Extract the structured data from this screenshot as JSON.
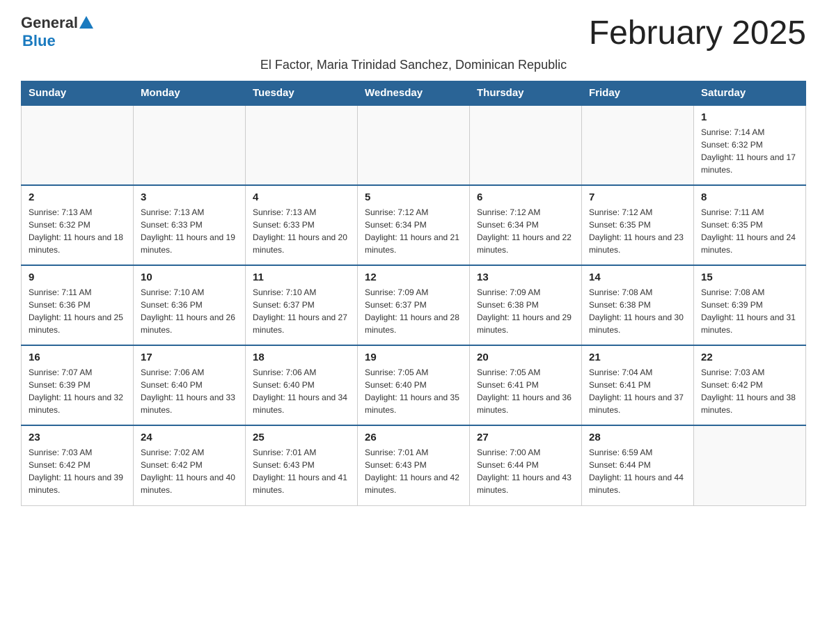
{
  "header": {
    "title": "February 2025",
    "location": "El Factor, Maria Trinidad Sanchez, Dominican Republic"
  },
  "logo": {
    "line1": "General",
    "line2": "Blue"
  },
  "weekdays": [
    "Sunday",
    "Monday",
    "Tuesday",
    "Wednesday",
    "Thursday",
    "Friday",
    "Saturday"
  ],
  "weeks": [
    {
      "days": [
        {
          "number": "",
          "info": ""
        },
        {
          "number": "",
          "info": ""
        },
        {
          "number": "",
          "info": ""
        },
        {
          "number": "",
          "info": ""
        },
        {
          "number": "",
          "info": ""
        },
        {
          "number": "",
          "info": ""
        },
        {
          "number": "1",
          "info": "Sunrise: 7:14 AM\nSunset: 6:32 PM\nDaylight: 11 hours and 17 minutes."
        }
      ]
    },
    {
      "days": [
        {
          "number": "2",
          "info": "Sunrise: 7:13 AM\nSunset: 6:32 PM\nDaylight: 11 hours and 18 minutes."
        },
        {
          "number": "3",
          "info": "Sunrise: 7:13 AM\nSunset: 6:33 PM\nDaylight: 11 hours and 19 minutes."
        },
        {
          "number": "4",
          "info": "Sunrise: 7:13 AM\nSunset: 6:33 PM\nDaylight: 11 hours and 20 minutes."
        },
        {
          "number": "5",
          "info": "Sunrise: 7:12 AM\nSunset: 6:34 PM\nDaylight: 11 hours and 21 minutes."
        },
        {
          "number": "6",
          "info": "Sunrise: 7:12 AM\nSunset: 6:34 PM\nDaylight: 11 hours and 22 minutes."
        },
        {
          "number": "7",
          "info": "Sunrise: 7:12 AM\nSunset: 6:35 PM\nDaylight: 11 hours and 23 minutes."
        },
        {
          "number": "8",
          "info": "Sunrise: 7:11 AM\nSunset: 6:35 PM\nDaylight: 11 hours and 24 minutes."
        }
      ]
    },
    {
      "days": [
        {
          "number": "9",
          "info": "Sunrise: 7:11 AM\nSunset: 6:36 PM\nDaylight: 11 hours and 25 minutes."
        },
        {
          "number": "10",
          "info": "Sunrise: 7:10 AM\nSunset: 6:36 PM\nDaylight: 11 hours and 26 minutes."
        },
        {
          "number": "11",
          "info": "Sunrise: 7:10 AM\nSunset: 6:37 PM\nDaylight: 11 hours and 27 minutes."
        },
        {
          "number": "12",
          "info": "Sunrise: 7:09 AM\nSunset: 6:37 PM\nDaylight: 11 hours and 28 minutes."
        },
        {
          "number": "13",
          "info": "Sunrise: 7:09 AM\nSunset: 6:38 PM\nDaylight: 11 hours and 29 minutes."
        },
        {
          "number": "14",
          "info": "Sunrise: 7:08 AM\nSunset: 6:38 PM\nDaylight: 11 hours and 30 minutes."
        },
        {
          "number": "15",
          "info": "Sunrise: 7:08 AM\nSunset: 6:39 PM\nDaylight: 11 hours and 31 minutes."
        }
      ]
    },
    {
      "days": [
        {
          "number": "16",
          "info": "Sunrise: 7:07 AM\nSunset: 6:39 PM\nDaylight: 11 hours and 32 minutes."
        },
        {
          "number": "17",
          "info": "Sunrise: 7:06 AM\nSunset: 6:40 PM\nDaylight: 11 hours and 33 minutes."
        },
        {
          "number": "18",
          "info": "Sunrise: 7:06 AM\nSunset: 6:40 PM\nDaylight: 11 hours and 34 minutes."
        },
        {
          "number": "19",
          "info": "Sunrise: 7:05 AM\nSunset: 6:40 PM\nDaylight: 11 hours and 35 minutes."
        },
        {
          "number": "20",
          "info": "Sunrise: 7:05 AM\nSunset: 6:41 PM\nDaylight: 11 hours and 36 minutes."
        },
        {
          "number": "21",
          "info": "Sunrise: 7:04 AM\nSunset: 6:41 PM\nDaylight: 11 hours and 37 minutes."
        },
        {
          "number": "22",
          "info": "Sunrise: 7:03 AM\nSunset: 6:42 PM\nDaylight: 11 hours and 38 minutes."
        }
      ]
    },
    {
      "days": [
        {
          "number": "23",
          "info": "Sunrise: 7:03 AM\nSunset: 6:42 PM\nDaylight: 11 hours and 39 minutes."
        },
        {
          "number": "24",
          "info": "Sunrise: 7:02 AM\nSunset: 6:42 PM\nDaylight: 11 hours and 40 minutes."
        },
        {
          "number": "25",
          "info": "Sunrise: 7:01 AM\nSunset: 6:43 PM\nDaylight: 11 hours and 41 minutes."
        },
        {
          "number": "26",
          "info": "Sunrise: 7:01 AM\nSunset: 6:43 PM\nDaylight: 11 hours and 42 minutes."
        },
        {
          "number": "27",
          "info": "Sunrise: 7:00 AM\nSunset: 6:44 PM\nDaylight: 11 hours and 43 minutes."
        },
        {
          "number": "28",
          "info": "Sunrise: 6:59 AM\nSunset: 6:44 PM\nDaylight: 11 hours and 44 minutes."
        },
        {
          "number": "",
          "info": ""
        }
      ]
    }
  ]
}
